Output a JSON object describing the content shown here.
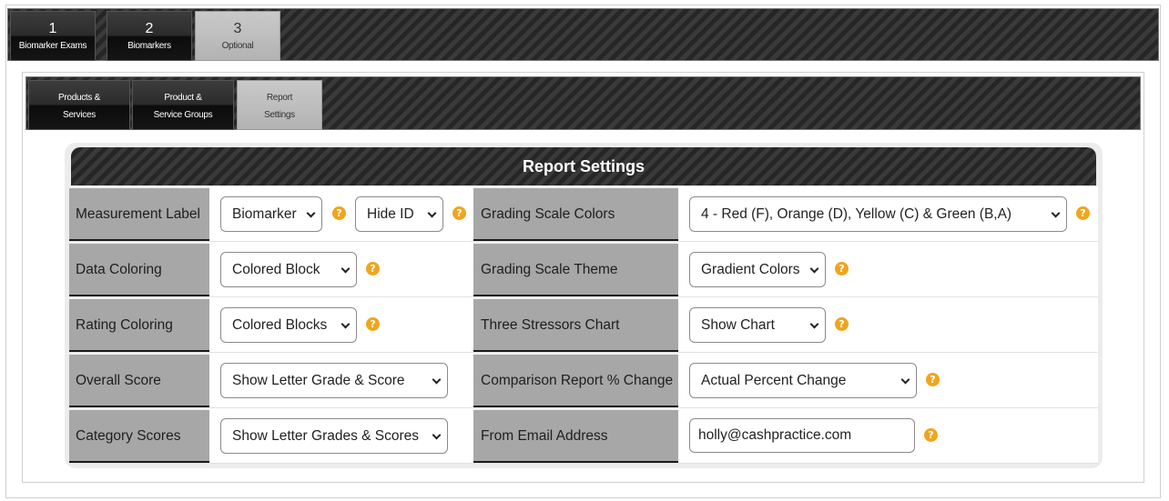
{
  "steps": [
    {
      "num": "1",
      "label": "Biomarker Exams"
    },
    {
      "num": "2",
      "label": "Biomarkers"
    },
    {
      "num": "3",
      "label": "Optional"
    }
  ],
  "subtabs": [
    {
      "line1": "Products &",
      "line2": "Services"
    },
    {
      "line1": "Product &",
      "line2": "Service Groups"
    },
    {
      "line1": "Report",
      "line2": "Settings"
    }
  ],
  "active_step": "3",
  "active_subtab": "Report Settings",
  "panel": {
    "title": "Report Settings"
  },
  "help_icon": "question-mark-circle-icon",
  "colors": {
    "accent_help": "#f0a51e",
    "label_bg": "#a7a7a7",
    "bar_dark": "#2b2b2b"
  },
  "rows": [
    {
      "left_label": "Measurement Label",
      "left_select_1": "Biomarker",
      "left_select_2": "Hide ID",
      "right_label": "Grading Scale Colors",
      "right_select": "4 - Red (F), Orange (D), Yellow (C) & Green (B,A)"
    },
    {
      "left_label": "Data Coloring",
      "left_select": "Colored Block",
      "right_label": "Grading Scale Theme",
      "right_select": "Gradient Colors"
    },
    {
      "left_label": "Rating Coloring",
      "left_select": "Colored Blocks",
      "right_label": "Three Stressors Chart",
      "right_select": "Show Chart"
    },
    {
      "left_label": "Overall Score",
      "left_select": "Show Letter Grade & Score",
      "right_label": "Comparison Report % Change",
      "right_select": "Actual Percent Change"
    },
    {
      "left_label": "Category Scores",
      "left_select": "Show Letter Grades & Scores",
      "right_label": "From Email Address",
      "right_input": "holly@cashpractice.com"
    }
  ]
}
